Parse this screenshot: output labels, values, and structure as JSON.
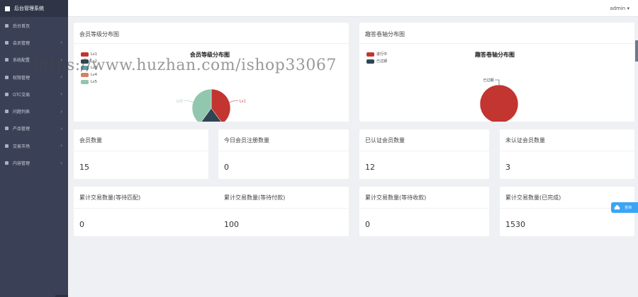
{
  "app": {
    "brand": "后台管理系统",
    "user": "admin"
  },
  "sidebar": {
    "items": [
      {
        "label": "后台首页",
        "has_children": false
      },
      {
        "label": "会员管理",
        "has_children": true
      },
      {
        "label": "系统配置",
        "has_children": true
      },
      {
        "label": "权限管理",
        "has_children": true
      },
      {
        "label": "OTC交易",
        "has_children": true
      },
      {
        "label": "问题列表",
        "has_children": true
      },
      {
        "label": "产品管理",
        "has_children": true
      },
      {
        "label": "交易市场",
        "has_children": true
      },
      {
        "label": "内容管理",
        "has_children": true
      }
    ]
  },
  "charts": {
    "level": {
      "panel_title": "会员等级分布图",
      "title": "会员等级分布图",
      "legend": [
        "Lv1",
        "Lv2",
        "Lv3",
        "Lv4",
        "Lv5"
      ],
      "colors": [
        "#c23531",
        "#2f4554",
        "#61a0a8",
        "#d48265",
        "#91c7ae"
      ]
    },
    "trade": {
      "panel_title": "趣答卷轴分布图",
      "title": "趣答卷轴分布图",
      "legend": [
        "进行中",
        "已过期"
      ],
      "colors": [
        "#c23531",
        "#2f4554"
      ]
    }
  },
  "chart_data": [
    {
      "type": "pie",
      "title": "会员等级分布图",
      "categories": [
        "Lv1",
        "Lv2",
        "Lv3",
        "Lv4",
        "Lv5"
      ],
      "values": [
        6,
        3,
        0,
        0,
        6
      ],
      "legend": "top-left"
    },
    {
      "type": "pie",
      "title": "趣答卷轴分布图",
      "categories": [
        "进行中",
        "已过期"
      ],
      "values": [
        1,
        0
      ],
      "legend": "top-left"
    }
  ],
  "stats_row1": [
    {
      "label": "会员数量",
      "value": "15"
    },
    {
      "label": "今日会员注册数量",
      "value": "0"
    },
    {
      "label": "已认证会员数量",
      "value": "12"
    },
    {
      "label": "未认证会员数量",
      "value": "3"
    }
  ],
  "stats_row2": [
    {
      "label": "累计交易数量(等待匹配)",
      "value": "0"
    },
    {
      "label": "累计交易数量(等待付款)",
      "value": "100"
    },
    {
      "label": "累计交易数量(等待收款)",
      "value": "0"
    },
    {
      "label": "累计交易数量(已完成)",
      "value": "1530"
    }
  ],
  "watermark": "https://www.huzhan.com/ishop33067",
  "float_button": {
    "label": "咨询"
  }
}
